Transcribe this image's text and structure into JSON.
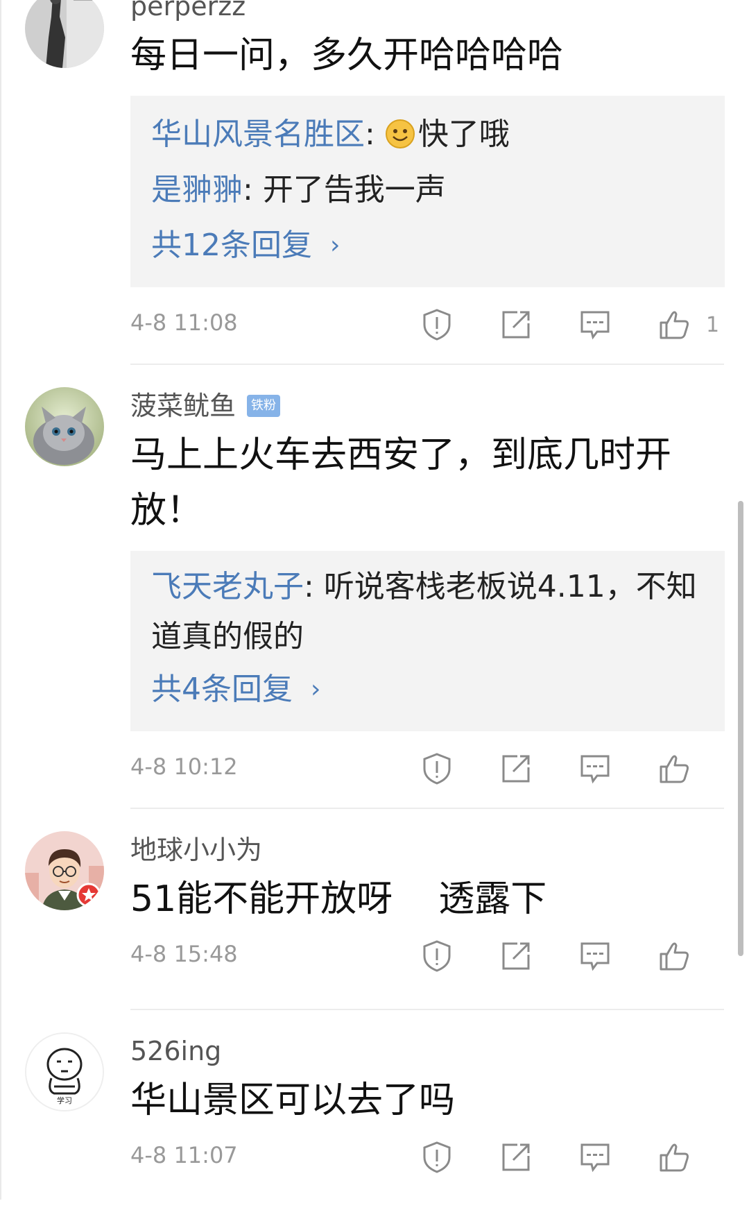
{
  "comments": [
    {
      "username": "perperzz",
      "text": "每日一问，多久开哈哈哈哈",
      "replies": [
        {
          "who": "华山风景名胜区",
          "text": "快了哦",
          "emoji": "smile"
        },
        {
          "who": "是翀翀",
          "text": "开了告我一声"
        }
      ],
      "more": "共12条回复",
      "time": "4-8  11:08",
      "likes": "1"
    },
    {
      "username": "菠菜鱿鱼",
      "badge": "铁粉",
      "text": "马上上火车去西安了，到底几时开放！",
      "replies": [
        {
          "who": "飞天老丸子",
          "text": "听说客栈老板说4.11，不知道真的假的"
        }
      ],
      "more": "共4条回复",
      "time": "4-8  10:12",
      "likes": ""
    },
    {
      "username": "地球小小为",
      "text": "51能不能开放呀    透露下",
      "time": "4-8  15:48",
      "likes": ""
    },
    {
      "username": "526ing",
      "text": "华山景区可以去了吗",
      "time": "4-8  11:07",
      "likes": ""
    }
  ],
  "icons": {
    "report": "shield-alert-icon",
    "share": "share-icon",
    "reply": "comment-icon",
    "like": "thumbs-up-icon"
  },
  "colors": {
    "link": "#4b7bb8",
    "meta": "#999999",
    "reply_bg": "#f3f3f3"
  },
  "avatar_caption_4": "学习"
}
